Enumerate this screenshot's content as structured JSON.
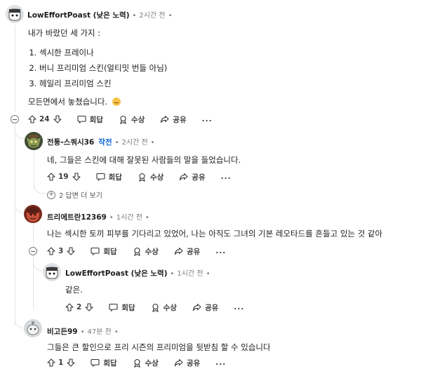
{
  "comments": [
    {
      "username": "LowEffortPoast (낮은 노력)",
      "time": "2시간 전",
      "avatar_icon": "snoo-avatar-icon",
      "body_intro": "내가 바랐던 세 가지 :",
      "list": [
        "섹시한 프레이나",
        "버니 프리미엄 스킨(얼티밋 번들 아님)",
        "헤일리 프리미엄 스킨"
      ],
      "body_outro": "모든면에서 놓쳤습니다.",
      "votes": "24",
      "reply_label": "회답",
      "award_label": "수상",
      "share_label": "공유",
      "more_label": "..."
    },
    {
      "username": "전통-스쿼시36",
      "op_badge": "작전",
      "time": "2시간 전",
      "avatar_icon": "goblin-avatar-icon",
      "body": "네, 그들은 스킨에 대해 잘못된 사람들의 말을 들었습니다.",
      "votes": "19",
      "reply_label": "회답",
      "award_label": "수상",
      "share_label": "공유",
      "more_label": "...",
      "more_replies": "2 답변 더 보기"
    },
    {
      "username": "트리에트란12369",
      "time": "1시간 전",
      "avatar_icon": "red-face-avatar-icon",
      "body": "나는 섹시한 토끼 피부를 기다리고 있었어, 나는 아직도 그녀의 기본 레오타드를 흔들고 있는 것 같아",
      "votes": "3",
      "reply_label": "회답",
      "award_label": "수상",
      "share_label": "공유",
      "more_label": "..."
    },
    {
      "username": "LowEffortPoast (낮은 노력)",
      "time": "1시간 전",
      "avatar_icon": "snoo-avatar-icon",
      "body": "같은.",
      "votes": "2",
      "reply_label": "회답",
      "award_label": "수상",
      "share_label": "공유",
      "more_label": "..."
    },
    {
      "username": "비고든99",
      "time": "47분 전",
      "avatar_icon": "grey-snoo-avatar-icon",
      "body": "그들은 큰 할인으로 프리 시즌의 프리미엄을 뒷받침 할 수 있습니다",
      "votes": "1",
      "reply_label": "회답",
      "award_label": "수상",
      "share_label": "공유",
      "more_label": "..."
    }
  ],
  "colors": {
    "op_badge": "#0a66d8",
    "meta": "#7c7c7c",
    "thread_line": "#e3e6e8"
  }
}
